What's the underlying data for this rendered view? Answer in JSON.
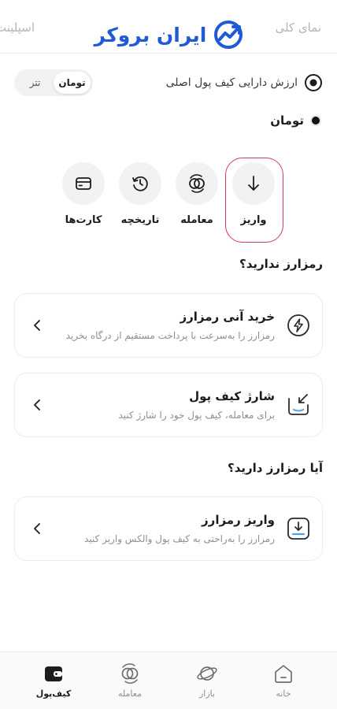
{
  "header": {
    "tab_right": "نمای کلی",
    "tab_left": "اسپلینت",
    "logo_text": "ایران بروکر",
    "logo_icon": "trend-up-icon"
  },
  "asset": {
    "label": "ارزش دارایی کیف پول اصلی",
    "eye_icon": "eye-icon",
    "toggle": {
      "option_active": "تومان",
      "option_inactive": "تتر"
    },
    "balance_label": "تومان"
  },
  "actions": [
    {
      "label": "واریز",
      "icon": "arrow-down-icon"
    },
    {
      "label": "معامله",
      "icon": "exchange-icon"
    },
    {
      "label": "تاریخچه",
      "icon": "history-icon"
    },
    {
      "label": "کارت‌ها",
      "icon": "card-icon"
    }
  ],
  "section_no_crypto": {
    "title": "رمزارز ندارید؟",
    "cards": [
      {
        "title": "خرید آنی رمزارز",
        "desc": "رمزارز را به‌سرعت با پرداخت مستقیم از درگاه بخرید",
        "icon": "lightning-icon"
      },
      {
        "title": "شارژ کیف پول",
        "desc": "برای معامله، کیف پول خود را شارژ کنید",
        "icon": "wallet-charge-icon"
      }
    ]
  },
  "section_has_crypto": {
    "title": "آیا رمزارز دارید؟",
    "cards": [
      {
        "title": "واریز رمزارز",
        "desc": "رمزارز را به‌راحتی به کیف پول والکس واریز کنید",
        "icon": "download-tray-icon"
      }
    ]
  },
  "bottom_nav": [
    {
      "label": "خانه",
      "icon": "home-icon"
    },
    {
      "label": "بازار",
      "icon": "planet-icon"
    },
    {
      "label": "معامله",
      "icon": "exchange-icon"
    },
    {
      "label": "کیف‌پول",
      "icon": "wallet-icon"
    }
  ],
  "colors": {
    "brand": "#1f5ad6",
    "highlight": "#d23a5c",
    "muted": "#8e8e93"
  }
}
